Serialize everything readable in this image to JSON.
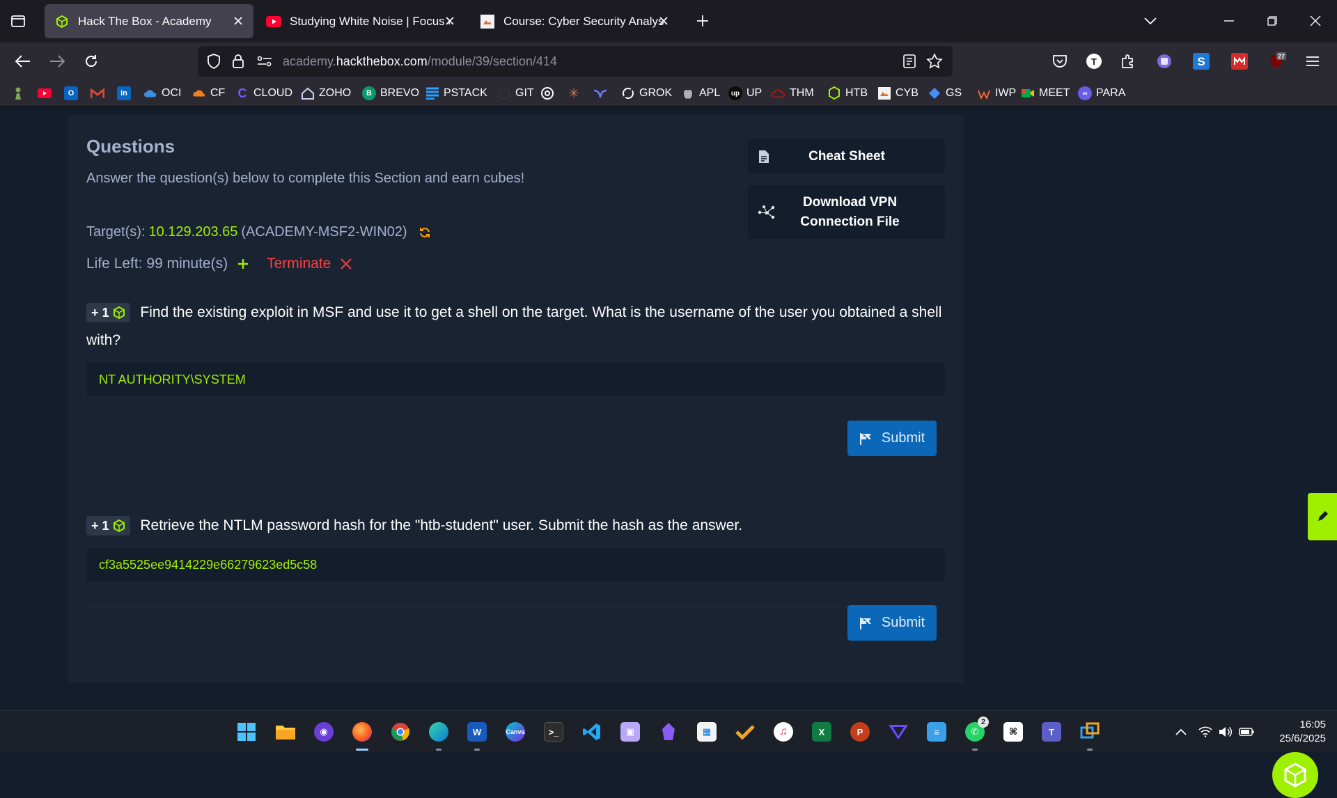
{
  "tabs": [
    {
      "title": "Hack The Box - Academy",
      "active": true
    },
    {
      "title": "Studying White Noise | Focus on",
      "active": false
    },
    {
      "title": "Course: Cyber Security Analyst -",
      "active": false
    }
  ],
  "url": {
    "prefix": "academy.",
    "host": "hackthebox.com",
    "path": "/module/39/section/414"
  },
  "extensions": {
    "notification_count": "27"
  },
  "bookmarks": [
    "OCI",
    "CF",
    "CLOUD",
    "ZOHO",
    "BREVO",
    "PSTACK",
    "GIT",
    "GROK",
    "APL",
    "UP",
    "THM",
    "HTB",
    "CYB",
    "GS",
    "IWP",
    "MEET",
    "PARA"
  ],
  "questions_panel": {
    "heading": "Questions",
    "subheading": "Answer the question(s) below to complete this Section and earn cubes!",
    "target_label": "Target(s):",
    "target_ip": "10.129.203.65",
    "target_host": "(ACADEMY-MSF2-WIN02)",
    "life_left": "Life Left: 99 minute(s)",
    "terminate_label": "Terminate"
  },
  "side_buttons": {
    "cheat_sheet": "Cheat Sheet",
    "vpn_line1": "Download VPN",
    "vpn_line2": "Connection File"
  },
  "questions": [
    {
      "badge": "+ 1",
      "text": "Find the existing exploit in MSF and use it to get a shell on the target. What is the username of the user you obtained a shell with?",
      "answer": "NT AUTHORITY\\SYSTEM",
      "submit_label": "Submit"
    },
    {
      "badge": "+ 1",
      "text": "Retrieve the NTLM password hash for the \"htb-student\" user. Submit the hash as the answer.",
      "answer": "cf3a5525ee9414229e66279623ed5c58",
      "submit_label": "Submit"
    }
  ],
  "taskbar": {
    "whatsapp_badge": "2",
    "time": "16:05",
    "date": "25/6/2025"
  },
  "colors": {
    "accent_green": "#9fef00",
    "danger": "#ff3e3e",
    "submit_blue": "#0b67b8",
    "page_bg": "#141d2b",
    "card_bg": "#1a2332"
  }
}
